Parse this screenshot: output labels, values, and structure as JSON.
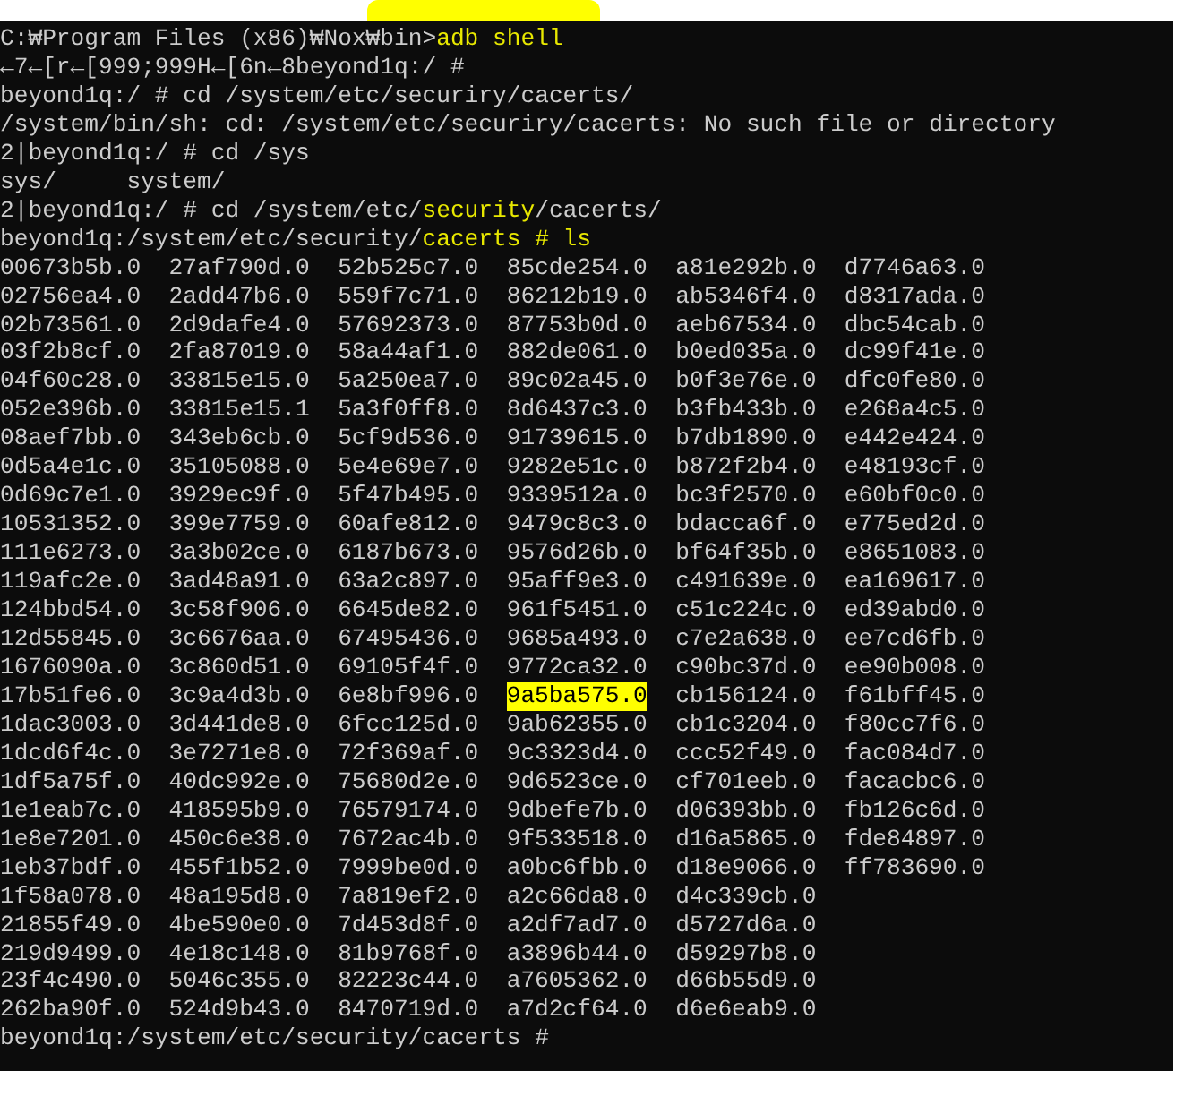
{
  "lines": [
    {
      "segments": [
        {
          "text": "C:₩Program Files (x86)₩Nox₩bin>",
          "marked": false
        },
        {
          "text": "adb shell",
          "marked": true
        }
      ]
    },
    {
      "segments": [
        {
          "text": "←7←[r←[999;999H←[6n←8beyond1q:/ #",
          "marked": false
        }
      ]
    },
    {
      "segments": [
        {
          "text": "beyond1q:/ # cd /system/etc/securiry/cacerts/",
          "marked": false
        }
      ]
    },
    {
      "segments": [
        {
          "text": "/system/bin/sh: cd: /system/etc/securiry/cacerts: No such file or directory",
          "marked": false
        }
      ]
    },
    {
      "segments": [
        {
          "text": "2|beyond1q:/ # cd /sys",
          "marked": false
        }
      ]
    },
    {
      "segments": [
        {
          "text": "sys/     system/",
          "marked": false
        }
      ]
    },
    {
      "segments": [
        {
          "text": "2|beyond1q:/ # cd /system/etc/",
          "marked": false
        },
        {
          "text": "security",
          "marked": true
        },
        {
          "text": "/cacerts/",
          "marked": false
        }
      ]
    },
    {
      "segments": [
        {
          "text": "beyond1q:/system/etc/security/",
          "marked": false
        },
        {
          "text": "cacerts # ls",
          "marked": true
        }
      ]
    }
  ],
  "listing": [
    [
      {
        "text": "00673b5b.0",
        "marked": false
      },
      {
        "text": "27af790d.0",
        "marked": false
      },
      {
        "text": "52b525c7.0",
        "marked": false
      },
      {
        "text": "85cde254.0",
        "marked": false
      },
      {
        "text": "a81e292b.0",
        "marked": false
      },
      {
        "text": "d7746a63.0",
        "marked": false
      }
    ],
    [
      {
        "text": "02756ea4.0",
        "marked": false
      },
      {
        "text": "2add47b6.0",
        "marked": false
      },
      {
        "text": "559f7c71.0",
        "marked": false
      },
      {
        "text": "86212b19.0",
        "marked": false
      },
      {
        "text": "ab5346f4.0",
        "marked": false
      },
      {
        "text": "d8317ada.0",
        "marked": false
      }
    ],
    [
      {
        "text": "02b73561.0",
        "marked": false
      },
      {
        "text": "2d9dafe4.0",
        "marked": false
      },
      {
        "text": "57692373.0",
        "marked": false
      },
      {
        "text": "87753b0d.0",
        "marked": false
      },
      {
        "text": "aeb67534.0",
        "marked": false
      },
      {
        "text": "dbc54cab.0",
        "marked": false
      }
    ],
    [
      {
        "text": "03f2b8cf.0",
        "marked": false
      },
      {
        "text": "2fa87019.0",
        "marked": false
      },
      {
        "text": "58a44af1.0",
        "marked": false
      },
      {
        "text": "882de061.0",
        "marked": false
      },
      {
        "text": "b0ed035a.0",
        "marked": false
      },
      {
        "text": "dc99f41e.0",
        "marked": false
      }
    ],
    [
      {
        "text": "04f60c28.0",
        "marked": false
      },
      {
        "text": "33815e15.0",
        "marked": false
      },
      {
        "text": "5a250ea7.0",
        "marked": false
      },
      {
        "text": "89c02a45.0",
        "marked": false
      },
      {
        "text": "b0f3e76e.0",
        "marked": false
      },
      {
        "text": "dfc0fe80.0",
        "marked": false
      }
    ],
    [
      {
        "text": "052e396b.0",
        "marked": false
      },
      {
        "text": "33815e15.1",
        "marked": false
      },
      {
        "text": "5a3f0ff8.0",
        "marked": false
      },
      {
        "text": "8d6437c3.0",
        "marked": false
      },
      {
        "text": "b3fb433b.0",
        "marked": false
      },
      {
        "text": "e268a4c5.0",
        "marked": false
      }
    ],
    [
      {
        "text": "08aef7bb.0",
        "marked": false
      },
      {
        "text": "343eb6cb.0",
        "marked": false
      },
      {
        "text": "5cf9d536.0",
        "marked": false
      },
      {
        "text": "91739615.0",
        "marked": false
      },
      {
        "text": "b7db1890.0",
        "marked": false
      },
      {
        "text": "e442e424.0",
        "marked": false
      }
    ],
    [
      {
        "text": "0d5a4e1c.0",
        "marked": false
      },
      {
        "text": "35105088.0",
        "marked": false
      },
      {
        "text": "5e4e69e7.0",
        "marked": false
      },
      {
        "text": "9282e51c.0",
        "marked": false
      },
      {
        "text": "b872f2b4.0",
        "marked": false
      },
      {
        "text": "e48193cf.0",
        "marked": false
      }
    ],
    [
      {
        "text": "0d69c7e1.0",
        "marked": false
      },
      {
        "text": "3929ec9f.0",
        "marked": false
      },
      {
        "text": "5f47b495.0",
        "marked": false
      },
      {
        "text": "9339512a.0",
        "marked": false
      },
      {
        "text": "bc3f2570.0",
        "marked": false
      },
      {
        "text": "e60bf0c0.0",
        "marked": false
      }
    ],
    [
      {
        "text": "10531352.0",
        "marked": false
      },
      {
        "text": "399e7759.0",
        "marked": false
      },
      {
        "text": "60afe812.0",
        "marked": false
      },
      {
        "text": "9479c8c3.0",
        "marked": false
      },
      {
        "text": "bdacca6f.0",
        "marked": false
      },
      {
        "text": "e775ed2d.0",
        "marked": false
      }
    ],
    [
      {
        "text": "111e6273.0",
        "marked": false
      },
      {
        "text": "3a3b02ce.0",
        "marked": false
      },
      {
        "text": "6187b673.0",
        "marked": false
      },
      {
        "text": "9576d26b.0",
        "marked": false
      },
      {
        "text": "bf64f35b.0",
        "marked": false
      },
      {
        "text": "e8651083.0",
        "marked": false
      }
    ],
    [
      {
        "text": "119afc2e.0",
        "marked": false
      },
      {
        "text": "3ad48a91.0",
        "marked": false
      },
      {
        "text": "63a2c897.0",
        "marked": false
      },
      {
        "text": "95aff9e3.0",
        "marked": false
      },
      {
        "text": "c491639e.0",
        "marked": false
      },
      {
        "text": "ea169617.0",
        "marked": false
      }
    ],
    [
      {
        "text": "124bbd54.0",
        "marked": false
      },
      {
        "text": "3c58f906.0",
        "marked": false
      },
      {
        "text": "6645de82.0",
        "marked": false
      },
      {
        "text": "961f5451.0",
        "marked": false
      },
      {
        "text": "c51c224c.0",
        "marked": false
      },
      {
        "text": "ed39abd0.0",
        "marked": false
      }
    ],
    [
      {
        "text": "12d55845.0",
        "marked": false
      },
      {
        "text": "3c6676aa.0",
        "marked": false
      },
      {
        "text": "67495436.0",
        "marked": false
      },
      {
        "text": "9685a493.0",
        "marked": false
      },
      {
        "text": "c7e2a638.0",
        "marked": false
      },
      {
        "text": "ee7cd6fb.0",
        "marked": false
      }
    ],
    [
      {
        "text": "1676090a.0",
        "marked": false
      },
      {
        "text": "3c860d51.0",
        "marked": false
      },
      {
        "text": "69105f4f.0",
        "marked": false
      },
      {
        "text": "9772ca32.0",
        "marked": false
      },
      {
        "text": "c90bc37d.0",
        "marked": false
      },
      {
        "text": "ee90b008.0",
        "marked": false
      }
    ],
    [
      {
        "text": "17b51fe6.0",
        "marked": false
      },
      {
        "text": "3c9a4d3b.0",
        "marked": false
      },
      {
        "text": "6e8bf996.0",
        "marked": false
      },
      {
        "text": "9a5ba575.0",
        "marked": true
      },
      {
        "text": "cb156124.0",
        "marked": false
      },
      {
        "text": "f61bff45.0",
        "marked": false
      }
    ],
    [
      {
        "text": "1dac3003.0",
        "marked": false
      },
      {
        "text": "3d441de8.0",
        "marked": false
      },
      {
        "text": "6fcc125d.0",
        "marked": false
      },
      {
        "text": "9ab62355.0",
        "marked": false
      },
      {
        "text": "cb1c3204.0",
        "marked": false
      },
      {
        "text": "f80cc7f6.0",
        "marked": false
      }
    ],
    [
      {
        "text": "1dcd6f4c.0",
        "marked": false
      },
      {
        "text": "3e7271e8.0",
        "marked": false
      },
      {
        "text": "72f369af.0",
        "marked": false
      },
      {
        "text": "9c3323d4.0",
        "marked": false
      },
      {
        "text": "ccc52f49.0",
        "marked": false
      },
      {
        "text": "fac084d7.0",
        "marked": false
      }
    ],
    [
      {
        "text": "1df5a75f.0",
        "marked": false
      },
      {
        "text": "40dc992e.0",
        "marked": false
      },
      {
        "text": "75680d2e.0",
        "marked": false
      },
      {
        "text": "9d6523ce.0",
        "marked": false
      },
      {
        "text": "cf701eeb.0",
        "marked": false
      },
      {
        "text": "facacbc6.0",
        "marked": false
      }
    ],
    [
      {
        "text": "1e1eab7c.0",
        "marked": false
      },
      {
        "text": "418595b9.0",
        "marked": false
      },
      {
        "text": "76579174.0",
        "marked": false
      },
      {
        "text": "9dbefe7b.0",
        "marked": false
      },
      {
        "text": "d06393bb.0",
        "marked": false
      },
      {
        "text": "fb126c6d.0",
        "marked": false
      }
    ],
    [
      {
        "text": "1e8e7201.0",
        "marked": false
      },
      {
        "text": "450c6e38.0",
        "marked": false
      },
      {
        "text": "7672ac4b.0",
        "marked": false
      },
      {
        "text": "9f533518.0",
        "marked": false
      },
      {
        "text": "d16a5865.0",
        "marked": false
      },
      {
        "text": "fde84897.0",
        "marked": false
      }
    ],
    [
      {
        "text": "1eb37bdf.0",
        "marked": false
      },
      {
        "text": "455f1b52.0",
        "marked": false
      },
      {
        "text": "7999be0d.0",
        "marked": false
      },
      {
        "text": "a0bc6fbb.0",
        "marked": false
      },
      {
        "text": "d18e9066.0",
        "marked": false
      },
      {
        "text": "ff783690.0",
        "marked": false
      }
    ],
    [
      {
        "text": "1f58a078.0",
        "marked": false
      },
      {
        "text": "48a195d8.0",
        "marked": false
      },
      {
        "text": "7a819ef2.0",
        "marked": false
      },
      {
        "text": "a2c66da8.0",
        "marked": false
      },
      {
        "text": "d4c339cb.0",
        "marked": false
      }
    ],
    [
      {
        "text": "21855f49.0",
        "marked": false
      },
      {
        "text": "4be590e0.0",
        "marked": false
      },
      {
        "text": "7d453d8f.0",
        "marked": false
      },
      {
        "text": "a2df7ad7.0",
        "marked": false
      },
      {
        "text": "d5727d6a.0",
        "marked": false
      }
    ],
    [
      {
        "text": "219d9499.0",
        "marked": false
      },
      {
        "text": "4e18c148.0",
        "marked": false
      },
      {
        "text": "81b9768f.0",
        "marked": false
      },
      {
        "text": "a3896b44.0",
        "marked": false
      },
      {
        "text": "d59297b8.0",
        "marked": false
      }
    ],
    [
      {
        "text": "23f4c490.0",
        "marked": false
      },
      {
        "text": "5046c355.0",
        "marked": false
      },
      {
        "text": "82223c44.0",
        "marked": false
      },
      {
        "text": "a7605362.0",
        "marked": false
      },
      {
        "text": "d66b55d9.0",
        "marked": false
      }
    ],
    [
      {
        "text": "262ba90f.0",
        "marked": false
      },
      {
        "text": "524d9b43.0",
        "marked": false
      },
      {
        "text": "8470719d.0",
        "marked": false
      },
      {
        "text": "a7d2cf64.0",
        "marked": false
      },
      {
        "text": "d6e6eab9.0",
        "marked": false
      }
    ]
  ],
  "prompt": "beyond1q:/system/etc/security/cacerts #"
}
